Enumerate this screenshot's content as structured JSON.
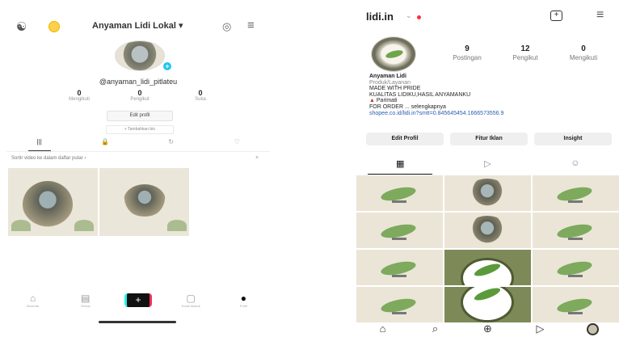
{
  "left": {
    "top_bar": {
      "add_user_icon": "add-user-icon",
      "coin_icon": "coin-icon",
      "title": "Anyaman Lidi Lokal ▾",
      "icon_1": "footprints-icon",
      "icon_2": "menu-icon"
    },
    "profile": {
      "handle": "@anyaman_lidi_pitlateu",
      "stats": [
        {
          "value": "0",
          "label": "Mengikuti"
        },
        {
          "value": "0",
          "label": "Pengikut"
        },
        {
          "value": "0",
          "label": "Suka"
        }
      ],
      "edit_button": "Edit profil",
      "bio_button": "+ Tambahkan bio"
    },
    "tabs": [
      "|||",
      "🔒",
      "↻",
      "♡"
    ],
    "sort_text": "Sortir video ke dalam daftar putar  ›",
    "sort_close": "×",
    "nav": [
      {
        "icon": "⌂",
        "label": "Beranda"
      },
      {
        "icon": "▤",
        "label": "Teman"
      },
      {
        "icon": "+",
        "label": ""
      },
      {
        "icon": "▢",
        "label": "Kotak Masuk"
      },
      {
        "icon": "●",
        "label": "Profil"
      }
    ]
  },
  "right": {
    "top_bar": {
      "username": "lidi.in",
      "chevron": "⌄",
      "plus_icon": "+",
      "menu_icon": "≡"
    },
    "stats": [
      {
        "value": "9",
        "label": "Postingan"
      },
      {
        "value": "12",
        "label": "Pengikut"
      },
      {
        "value": "0",
        "label": "Mengikuti"
      }
    ],
    "bio": {
      "name": "Anyaman Lidi",
      "category": "Produk/Layanan",
      "line1": "MADE WITH PRIDE",
      "line2": "KUALITAS LIDIKU,HASIL ANYAMANKU",
      "line3": "Parimati",
      "line4": "FOR ORDER ... selengkapnya",
      "link": "shopee.co.id/lidi.in?smtt=0.845645454.1666573556.9"
    },
    "buttons": [
      "Edit Profil",
      "Fitur Iklan",
      "Insight"
    ],
    "tabs": [
      "▦",
      "▷",
      "☺"
    ],
    "nav": [
      "⌂",
      "⌕",
      "⊕",
      "▷"
    ]
  }
}
